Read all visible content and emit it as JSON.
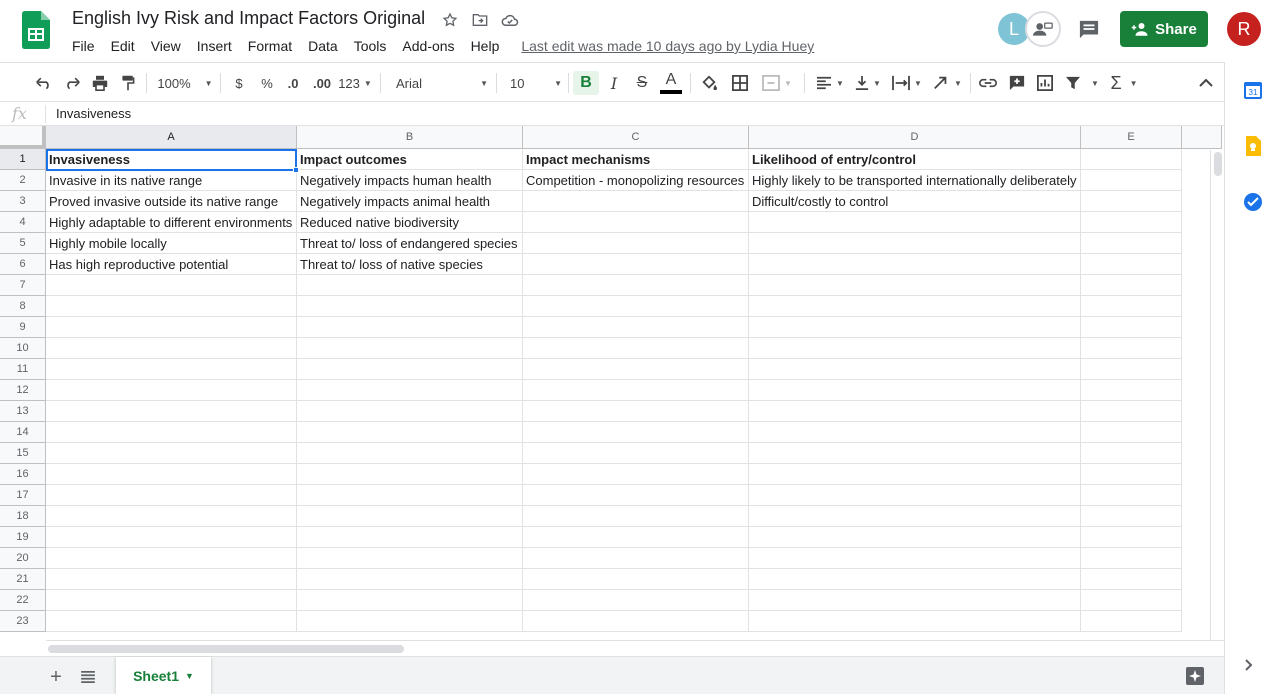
{
  "doc": {
    "title": "English Ivy Risk and Impact Factors Original",
    "last_edit": "Last edit was made 10 days ago by Lydia Huey"
  },
  "menu": [
    "File",
    "Edit",
    "View",
    "Insert",
    "Format",
    "Data",
    "Tools",
    "Add-ons",
    "Help"
  ],
  "collaborators": {
    "avatar_l": "L",
    "user_initial": "R"
  },
  "share_label": "Share",
  "toolbar": {
    "zoom": "100%",
    "currency": "$",
    "percent": "%",
    "decrease_decimal": ".0",
    "increase_decimal": ".00",
    "more_formats": "123",
    "font": "Arial",
    "font_size": "10",
    "bold": "B",
    "italic": "I",
    "strike": "S",
    "text_color": "A"
  },
  "formula_bar": {
    "fx": "fx",
    "content": "Invasiveness"
  },
  "columns": [
    "A",
    "B",
    "C",
    "D",
    "E"
  ],
  "rows": [
    "1",
    "2",
    "3",
    "4",
    "5",
    "6",
    "7",
    "8",
    "9",
    "10",
    "11",
    "12",
    "13",
    "14",
    "15",
    "16",
    "17",
    "18",
    "19",
    "20",
    "21",
    "22",
    "23"
  ],
  "cells": [
    [
      "Invasiveness",
      "Impact outcomes",
      "Impact mechanisms",
      "Likelihood of entry/control",
      ""
    ],
    [
      "Invasive in its native range",
      "Negatively impacts human health",
      "Competition - monopolizing resources",
      "Highly likely to be transported internationally deliberately",
      ""
    ],
    [
      "Proved invasive outside its native range",
      "Negatively impacts animal health",
      "",
      "Difficult/costly to control",
      ""
    ],
    [
      "Highly adaptable to different environments",
      "Reduced native biodiversity",
      "",
      "",
      ""
    ],
    [
      "Highly mobile locally",
      "Threat to/ loss of endangered species",
      "",
      "",
      ""
    ],
    [
      "Has high reproductive potential",
      "Threat to/ loss of native species",
      "",
      "",
      ""
    ]
  ],
  "sheet_tab": "Sheet1",
  "side": {
    "calendar_day": "31"
  },
  "colors": {
    "share_green": "#188038",
    "selection_blue": "#1a73e8",
    "avatar_red": "#c5221f"
  }
}
